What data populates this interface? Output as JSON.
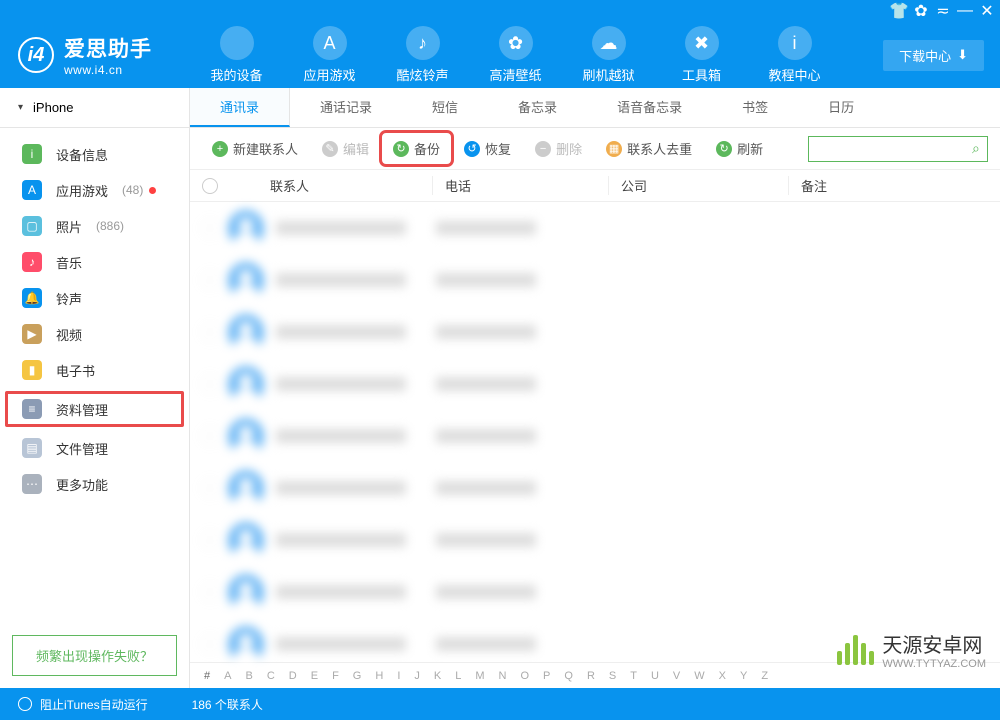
{
  "app": {
    "name": "爱思助手",
    "url": "www.i4.cn"
  },
  "titlebar_icons": [
    "shirt",
    "gear",
    "dropdown",
    "minimize",
    "close"
  ],
  "nav": [
    {
      "label": "我的设备"
    },
    {
      "label": "应用游戏"
    },
    {
      "label": "酷炫铃声"
    },
    {
      "label": "高清壁纸"
    },
    {
      "label": "刷机越狱"
    },
    {
      "label": "工具箱"
    },
    {
      "label": "教程中心"
    }
  ],
  "download_center": "下载中心",
  "device": "iPhone",
  "sidebar": [
    {
      "label": "设备信息",
      "color": "#5cb85c",
      "icon": "i"
    },
    {
      "label": "应用游戏",
      "color": "#0893ee",
      "icon": "A",
      "count": "(48)",
      "dot": true
    },
    {
      "label": "照片",
      "color": "#5bc0de",
      "icon": "▢",
      "count": "(886)"
    },
    {
      "label": "音乐",
      "color": "#ff4d6a",
      "icon": "♪"
    },
    {
      "label": "铃声",
      "color": "#0893ee",
      "icon": "🔔"
    },
    {
      "label": "视频",
      "color": "#c9a05c",
      "icon": "▶"
    },
    {
      "label": "电子书",
      "color": "#f5c542",
      "icon": "▮"
    },
    {
      "label": "资料管理",
      "color": "#8b9bb4",
      "icon": "≡",
      "hl": true
    },
    {
      "label": "文件管理",
      "color": "#b8c5d6",
      "icon": "▤"
    },
    {
      "label": "更多功能",
      "color": "#aab2bd",
      "icon": "⋯"
    }
  ],
  "faq": "频繁出现操作失败？",
  "tabs": [
    "通讯录",
    "通话记录",
    "短信",
    "备忘录",
    "语音备忘录",
    "书签",
    "日历"
  ],
  "active_tab": 0,
  "toolbar": [
    {
      "label": "新建联系人",
      "icon": "+",
      "c": "green"
    },
    {
      "label": "编辑",
      "icon": "✎",
      "c": "gray",
      "disabled": true
    },
    {
      "label": "备份",
      "icon": "↻",
      "c": "green",
      "hl": true
    },
    {
      "label": "恢复",
      "icon": "↺",
      "c": "blue"
    },
    {
      "label": "删除",
      "icon": "−",
      "c": "gray",
      "disabled": true
    },
    {
      "label": "联系人去重",
      "icon": "▦",
      "c": "orange"
    },
    {
      "label": "刷新",
      "icon": "↻",
      "c": "green"
    }
  ],
  "columns": {
    "contact": "联系人",
    "phone": "电话",
    "company": "公司",
    "note": "备注"
  },
  "alpha": [
    "#",
    "A",
    "B",
    "C",
    "D",
    "E",
    "F",
    "G",
    "H",
    "I",
    "J",
    "K",
    "L",
    "M",
    "N",
    "O",
    "P",
    "Q",
    "R",
    "S",
    "T",
    "U",
    "V",
    "W",
    "X",
    "Y",
    "Z"
  ],
  "footer": {
    "itunes": "阻止iTunes自动运行",
    "count": "186 个联系人"
  },
  "watermark": {
    "brand": "天源安卓网",
    "sub": "WWW.TYTYAZ.COM"
  }
}
